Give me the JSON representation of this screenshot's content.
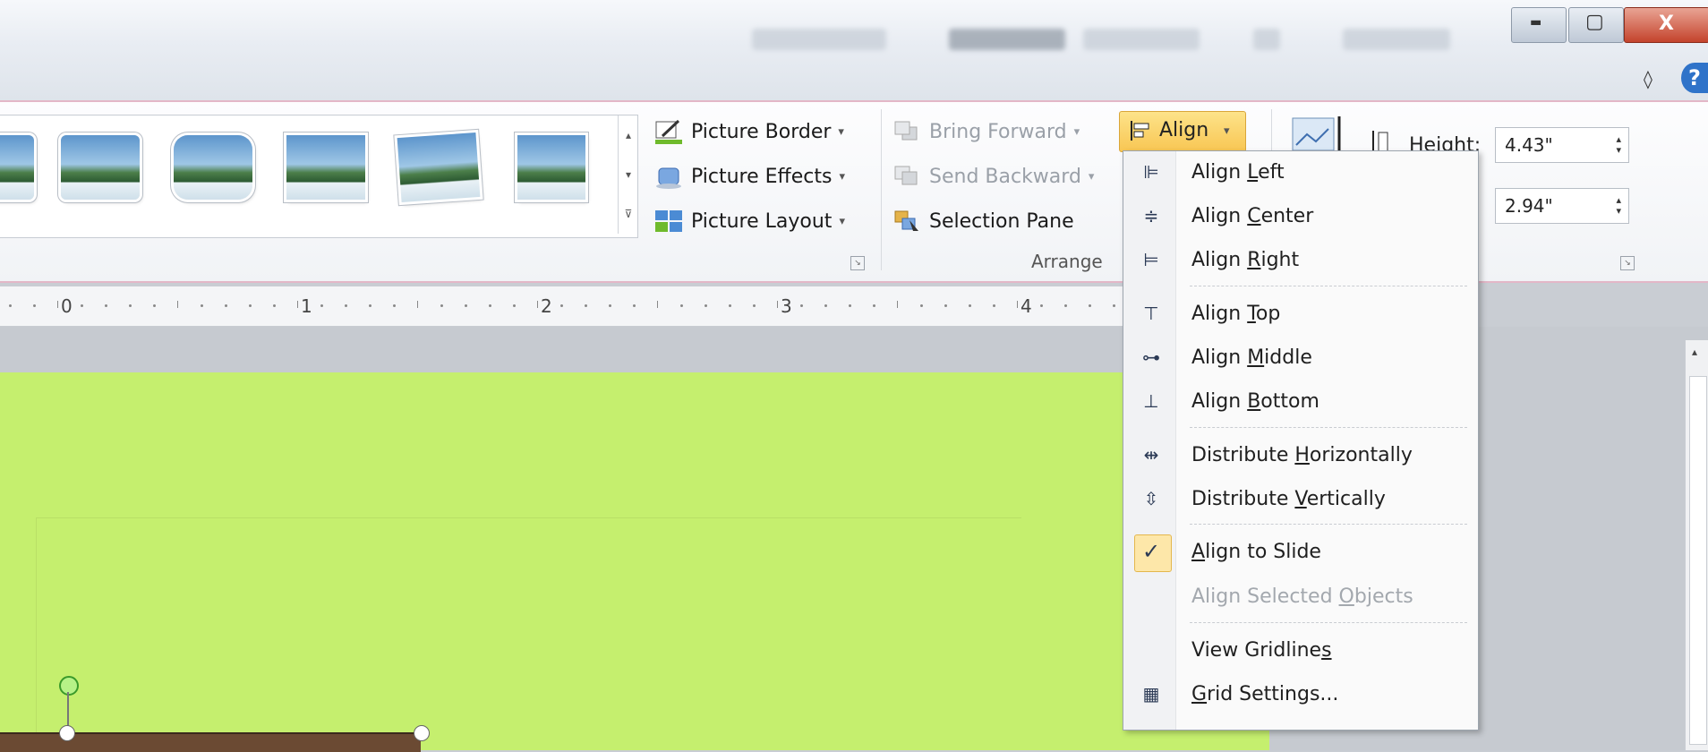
{
  "titlebar": {
    "minimize_glyph": "▬",
    "maximize_glyph": "▢",
    "close_glyph": "X",
    "ribbon_minimize_glyph": "◊",
    "help_glyph": "?"
  },
  "ribbon": {
    "picture_styles": {
      "scroll_up": "▴",
      "scroll_down": "▾",
      "more": "⊽"
    },
    "picture_border": "Picture Border",
    "picture_effects": "Picture Effects",
    "picture_layout": "Picture Layout",
    "arrange": {
      "bring_forward": "Bring Forward",
      "send_backward": "Send Backward",
      "selection_pane": "Selection Pane",
      "align": "Align",
      "group_label": "Arrange"
    },
    "size": {
      "height_label": "Height:",
      "height_value": "4.43\"",
      "width_value": "2.94\""
    },
    "caret": "▾",
    "launcher": "↘"
  },
  "ruler": {
    "numbers": [
      "0",
      "1",
      "2",
      "3",
      "4"
    ]
  },
  "align_menu": {
    "items": [
      {
        "pre": "Align ",
        "u": "L",
        "post": "eft",
        "icon": "align-left-icon",
        "glyph": "⊫",
        "enabled": true
      },
      {
        "pre": "Align ",
        "u": "C",
        "post": "enter",
        "icon": "align-center-icon",
        "glyph": "≑",
        "enabled": true
      },
      {
        "pre": "Align ",
        "u": "R",
        "post": "ight",
        "icon": "align-right-icon",
        "glyph": "⊨",
        "enabled": true
      },
      {
        "pre": "Align ",
        "u": "T",
        "post": "op",
        "icon": "align-top-icon",
        "glyph": "⊤",
        "enabled": true
      },
      {
        "pre": "Align ",
        "u": "M",
        "post": "iddle",
        "icon": "align-middle-icon",
        "glyph": "⊶",
        "enabled": true
      },
      {
        "pre": "Align ",
        "u": "B",
        "post": "ottom",
        "icon": "align-bottom-icon",
        "glyph": "⊥",
        "enabled": true
      },
      {
        "pre": "Distribute ",
        "u": "H",
        "post": "orizontally",
        "icon": "distribute-horizontally-icon",
        "glyph": "⇹",
        "enabled": true
      },
      {
        "pre": "Distribute ",
        "u": "V",
        "post": "ertically",
        "icon": "distribute-vertically-icon",
        "glyph": "⇳",
        "enabled": true
      },
      {
        "pre": "",
        "u": "A",
        "post": "lign to Slide",
        "icon": "checkmark-icon",
        "glyph": "✓",
        "enabled": true,
        "checked": true
      },
      {
        "pre": "Align Selected ",
        "u": "O",
        "post": "bjects",
        "icon": "",
        "glyph": "",
        "enabled": false
      },
      {
        "pre": "View Gridline",
        "u": "s",
        "post": "",
        "icon": "",
        "glyph": "",
        "enabled": true
      },
      {
        "pre": "",
        "u": "G",
        "post": "rid Settings...",
        "icon": "grid-icon",
        "glyph": "▦",
        "enabled": true
      }
    ]
  },
  "colors": {
    "slide": "#c5ef6e",
    "menu_highlight": "#fde7a9",
    "align_button": "#f8c653"
  }
}
